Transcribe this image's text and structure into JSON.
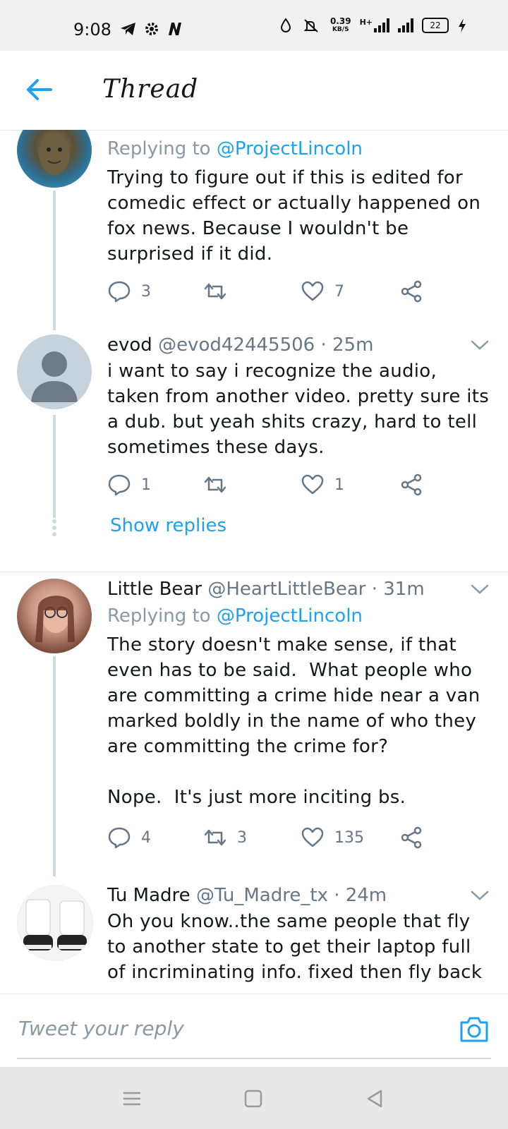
{
  "status_bar": {
    "time": "9:08",
    "net_speed_value": "0.39",
    "net_speed_unit": "KB/S",
    "network_type": "H+",
    "battery": "22"
  },
  "header": {
    "title": "Thread"
  },
  "tweets": [
    {
      "replying_label": "Replying to",
      "replying_handle": "@ProjectLincoln",
      "text": "Trying to figure out if this is edited for comedic effect or actually happened on fox news. Because I wouldn't be surprised if it did.",
      "replies": "3",
      "retweets": "",
      "likes": "7"
    },
    {
      "name": "evod",
      "handle": "@evod42445506",
      "time": "· 25m",
      "text": "i want to say i recognize the audio, taken from another video. pretty sure its a dub. but yeah shits crazy, hard to tell sometimes these days.",
      "replies": "1",
      "retweets": "",
      "likes": "1",
      "show_replies": "Show replies"
    },
    {
      "name": "Little Bear",
      "handle": "@HeartLittleBear",
      "time": "· 31m",
      "replying_label": "Replying to",
      "replying_handle": "@ProjectLincoln",
      "text": "The story doesn't make sense, if that even has to be said.  What people who are committing a crime hide near a van marked boldly in the name of who they are committing the crime for?\n\nNope.  It's just more inciting bs.",
      "replies": "4",
      "retweets": "3",
      "likes": "135"
    },
    {
      "name": "Tu Madre",
      "handle": "@Tu_Madre_tx",
      "time": "· 24m",
      "text": "Oh you know..the same people that fly to another state to get their laptop full of incriminating info. fixed then fly back"
    }
  ],
  "compose": {
    "placeholder": "Tweet your reply"
  },
  "colors": {
    "accent": "#1da1f2",
    "muted": "#657786",
    "thread_line": "#cfd9de"
  }
}
